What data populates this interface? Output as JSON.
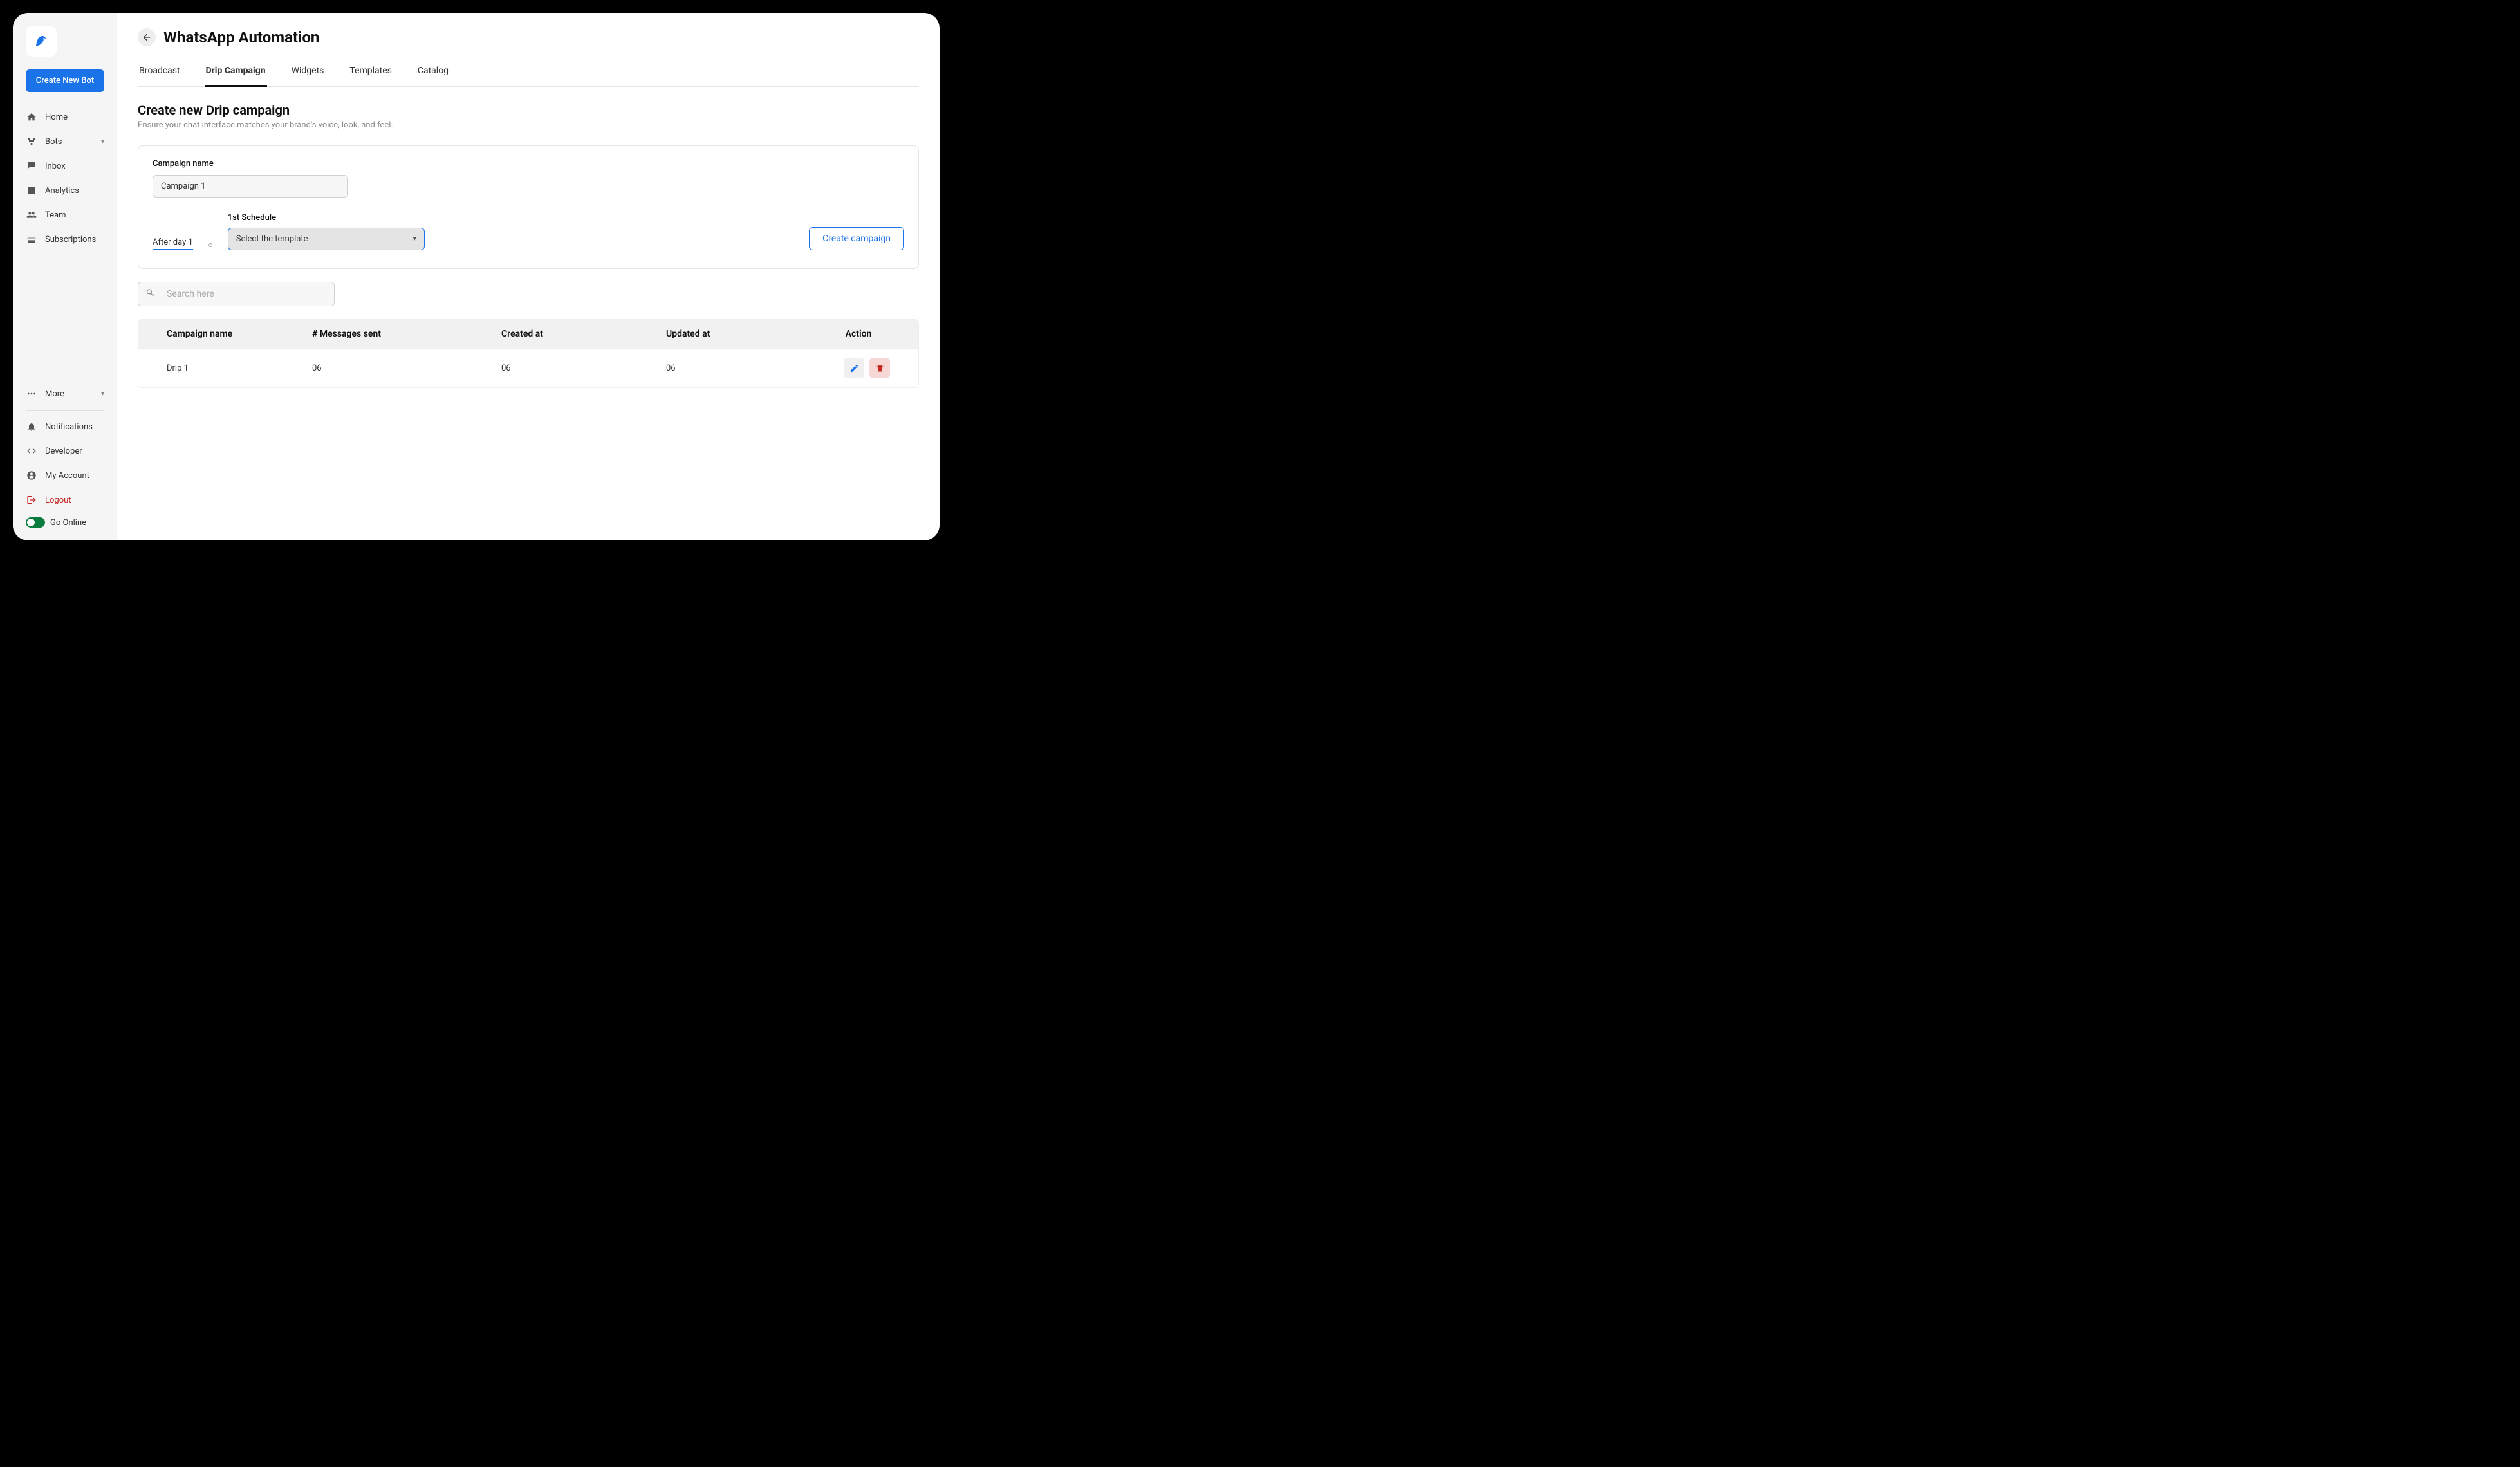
{
  "sidebar": {
    "create_bot_label": "Create New Bot",
    "items": [
      {
        "label": "Home"
      },
      {
        "label": "Bots"
      },
      {
        "label": "Inbox"
      },
      {
        "label": "Analytics"
      },
      {
        "label": "Team"
      },
      {
        "label": "Subscriptions"
      }
    ],
    "more_label": "More",
    "notifications_label": "Notifications",
    "developer_label": "Developer",
    "my_account_label": "My Account",
    "logout_label": "Logout",
    "go_online_label": "Go Online"
  },
  "header": {
    "title": "WhatsApp Automation"
  },
  "tabs": [
    {
      "label": "Broadcast",
      "active": false
    },
    {
      "label": "Drip Campaign",
      "active": true
    },
    {
      "label": "Widgets",
      "active": false
    },
    {
      "label": "Templates",
      "active": false
    },
    {
      "label": "Catalog",
      "active": false
    }
  ],
  "section": {
    "title": "Create new Drip campaign",
    "subtitle": "Ensure your chat interface matches your brand's voice, look, and feel."
  },
  "form": {
    "campaign_name_label": "Campaign name",
    "campaign_name_value": "Campaign 1",
    "after_day_label": "After day 1",
    "schedule_label": "1st Schedule",
    "template_select_label": "Select the template",
    "create_campaign_label": "Create campaign"
  },
  "search": {
    "placeholder": "Search here"
  },
  "table": {
    "headers": {
      "name": "Campaign name",
      "messages": "# Messages sent",
      "created": "Created at",
      "updated": "Updated at",
      "action": "Action"
    },
    "rows": [
      {
        "name": "Drip 1",
        "messages": "06",
        "created": "06",
        "updated": "06"
      }
    ]
  }
}
